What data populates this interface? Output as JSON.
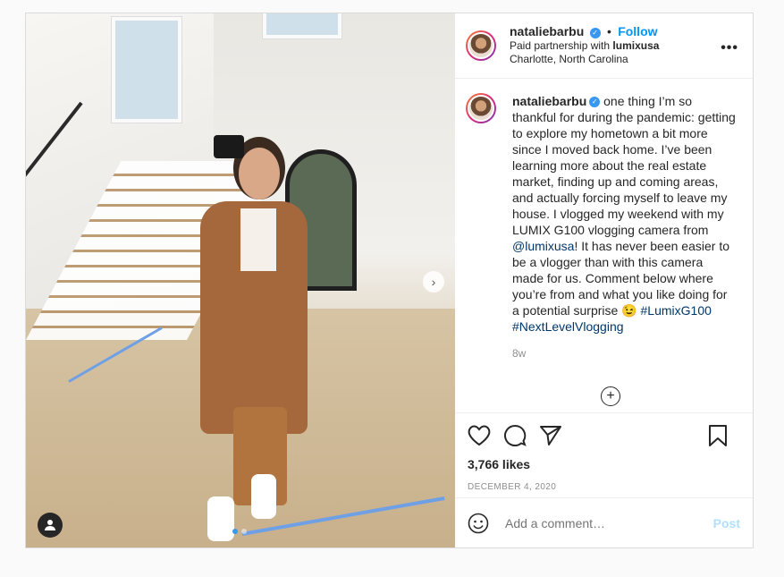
{
  "post": {
    "username": "nataliebarbu",
    "follow_label": "Follow",
    "partnership_prefix": "Paid partnership with",
    "partner": "lumixusa",
    "location": "Charlotte, North Carolina",
    "more_icon": "more-horizontal-icon"
  },
  "caption": {
    "username": "nataliebarbu",
    "text_part1": "one thing I’m so thankful for during the pandemic: getting to explore my hometown a bit more since I moved back home. I’ve been learning more about the real estate market, finding up and coming areas, and actually forcing myself to leave my house. I vlogged my weekend with my LUMIX G100 vlogging camera from",
    "mention": "@lumixusa",
    "text_part2": "! It has never been easier to be a vlogger than with this camera made for us. Comment below where you’re from and what you like doing for a potential surprise 😉",
    "tag1": "#LumixG100",
    "tag2": "#NextLevelVlogging",
    "age": "8w"
  },
  "engagement": {
    "likes": "3,766 likes",
    "date": "DECEMBER 4, 2020"
  },
  "comment_box": {
    "placeholder": "Add a comment…",
    "post_label": "Post"
  },
  "carousel": {
    "slide_count": 2,
    "current_slide": 1
  },
  "colors": {
    "link": "#0095f6",
    "mention": "#00376b",
    "post_disabled": "#b2dffc"
  }
}
